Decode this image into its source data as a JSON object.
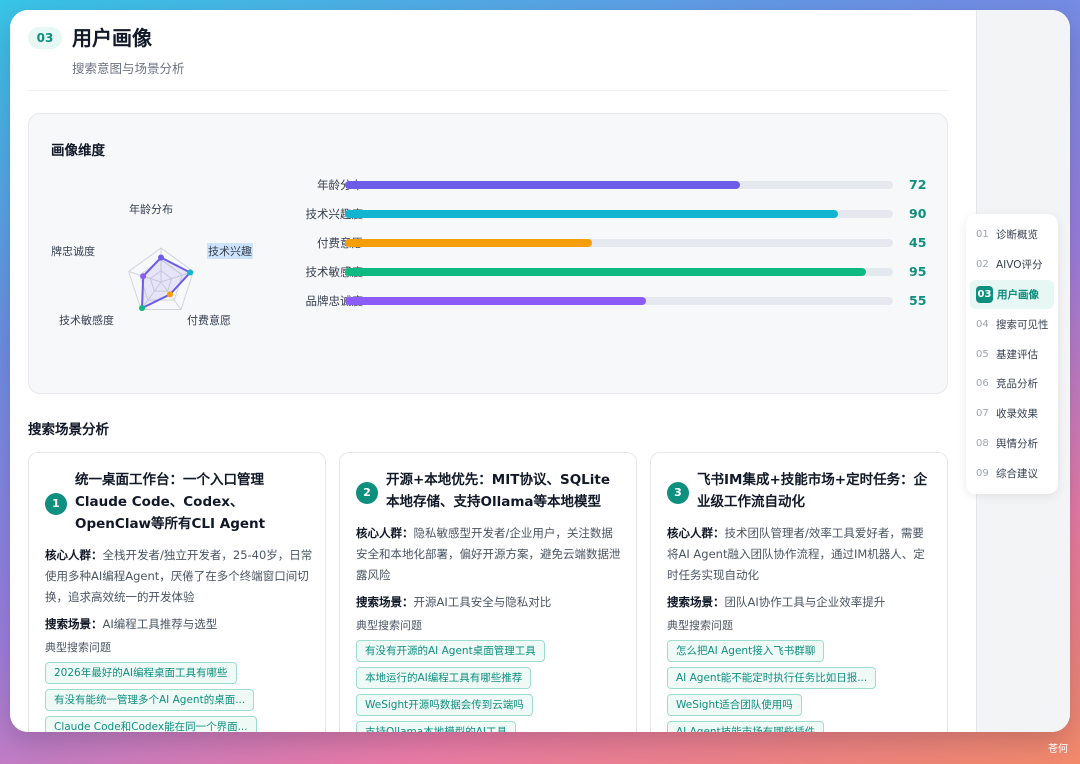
{
  "header": {
    "section_num": "03",
    "title": "用户画像",
    "subtitle": "搜索意图与场景分析"
  },
  "dimension": {
    "title": "画像维度",
    "radar_labels": [
      "年龄分布",
      "技术兴趣",
      "付费意愿",
      "技术敏感度",
      "牌忠诚度"
    ],
    "bars": [
      {
        "label": "年龄分布",
        "value": 72,
        "color": "#6c5ce7"
      },
      {
        "label": "技术兴趣度",
        "value": 90,
        "color": "#11b5cf"
      },
      {
        "label": "付费意愿",
        "value": 45,
        "color": "#f59e0b"
      },
      {
        "label": "技术敏感度",
        "value": 95,
        "color": "#10b981"
      },
      {
        "label": "品牌忠诚度",
        "value": 55,
        "color": "#8b5cf6"
      }
    ],
    "value_color": "#0f8f7e"
  },
  "scenarios": {
    "title": "搜索场景分析",
    "crowd_label": "核心人群：",
    "scene_label": "搜索场景：",
    "query_label": "典型搜索问题",
    "cards": [
      {
        "num": "1",
        "title": "统一桌面工作台：一个入口管理Claude Code、Codex、OpenClaw等所有CLI Agent",
        "crowd": "全栈开发者/独立开发者，25-40岁，日常使用多种AI编程Agent，厌倦了在多个终端窗口间切换，追求高效统一的开发体验",
        "scene": "AI编程工具推荐与选型",
        "queries": [
          "2026年最好的AI编程桌面工具有哪些",
          "有没有能统一管理多个AI Agent的桌面...",
          "Claude Code和Codex能在同一个界面..."
        ]
      },
      {
        "num": "2",
        "title": "开源+本地优先：MIT协议、SQLite本地存储、支持Ollama等本地模型",
        "crowd": "隐私敏感型开发者/企业用户，关注数据安全和本地化部署，偏好开源方案，避免云端数据泄露风险",
        "scene": "开源AI工具安全与隐私对比",
        "queries": [
          "有没有开源的AI Agent桌面管理工具",
          "本地运行的AI编程工具有哪些推荐",
          "WeSight开源吗数据会传到云端吗",
          "支持Ollama本地模型的AI工具"
        ]
      },
      {
        "num": "3",
        "title": "飞书IM集成+技能市场+定时任务：企业级工作流自动化",
        "crowd": "技术团队管理者/效率工具爱好者，需要将AI Agent融入团队协作流程，通过IM机器人、定时任务实现自动化",
        "scene": "团队AI协作工具与企业效率提升",
        "queries": [
          "怎么把AI Agent接入飞书群聊",
          "AI Agent能不能定时执行任务比如日报...",
          "WeSight适合团队使用吗",
          "AI Agent技能市场有哪些插件"
        ]
      }
    ]
  },
  "nav": {
    "items": [
      {
        "num": "01",
        "label": "诊断概览"
      },
      {
        "num": "02",
        "label": "AIVO评分"
      },
      {
        "num": "03",
        "label": "用户画像",
        "active": true
      },
      {
        "num": "04",
        "label": "搜索可见性"
      },
      {
        "num": "05",
        "label": "基建评估"
      },
      {
        "num": "06",
        "label": "竞品分析"
      },
      {
        "num": "07",
        "label": "收录效果"
      },
      {
        "num": "08",
        "label": "舆情分析"
      },
      {
        "num": "09",
        "label": "综合建议"
      }
    ]
  },
  "watermark": "苍何"
}
